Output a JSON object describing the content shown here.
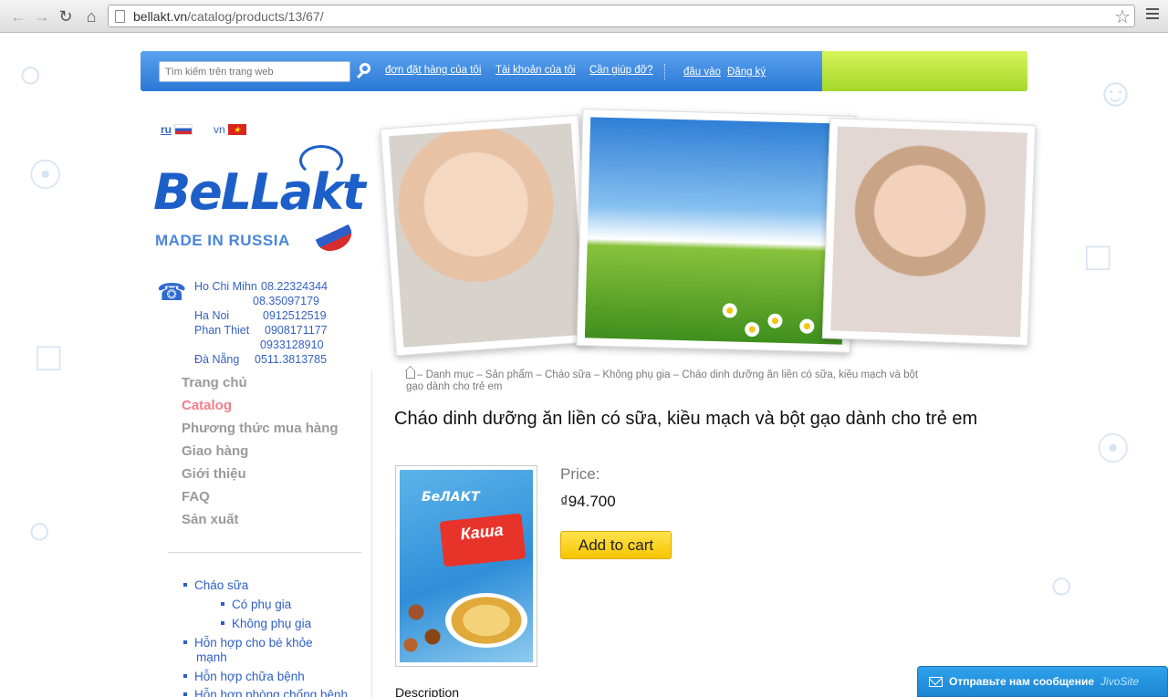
{
  "browser": {
    "url_host": "bellakt.vn",
    "url_path": "/catalog/products/13/67/"
  },
  "topbar": {
    "search_placeholder": "Tìm kiếm trên trang web",
    "links": [
      "đơn đặt hàng của tôi",
      "Tài khoản của tôi",
      "Cần giúp đỡ?"
    ],
    "login": "đâu vào",
    "register": "Đăng ký"
  },
  "languages": [
    {
      "code": "ru",
      "flag": "russia-flag"
    },
    {
      "code": "vn",
      "flag": "vietnam-flag"
    }
  ],
  "logo": {
    "brand": "BeLLakt",
    "tagline": "MADE IN RUSSIA"
  },
  "contacts": {
    "hcm_label": "Ho Chi Mihn",
    "hcm_phone1": "08.22324344",
    "hcm_phone2": "08.35097179",
    "hanoi_label": "Ha Noi",
    "hanoi_phone": "0912512519",
    "phanthiet_label": "Phan Thiet",
    "phanthiet_phone1": "0908171177",
    "phanthiet_phone2": "0933128910",
    "danang_label": "Đà Nẵng",
    "danang_phone": "0511.3813785"
  },
  "menu": [
    "Trang chủ",
    "Catalog",
    "Phương thức mua hàng",
    "Giao hàng",
    "Giới thiệu",
    "FAQ",
    "Sản xuất"
  ],
  "categories": [
    {
      "label": "Cháo sữa"
    },
    {
      "label": "Có phụ gia"
    },
    {
      "label": "Không phụ gia"
    },
    {
      "label": "Hỗn hợp cho bé khỏe"
    },
    {
      "label": "mạnh"
    },
    {
      "label": "Hỗn hợp chữa bệnh"
    },
    {
      "label": "Hỗn hợp phòng chống bệnh"
    }
  ],
  "breadcrumb": {
    "line1": "– Danh mục – Sản phẩm – Cháo sữa – Không phụ gia –  Cháo dinh dưỡng ăn liền có sữa, kiều mạch và bột",
    "line2": "gạo dành cho trẻ em"
  },
  "product": {
    "title": "Cháo dinh dưỡng ăn liền có sữa, kiều mạch và bột gạo dành cho trẻ em",
    "box_brand": "БеЛАКТ",
    "box_name": "Каша",
    "price_label": "Price:",
    "price": "₫94.700",
    "add_to_cart": "Add to cart",
    "description_heading": "Description"
  },
  "chat_widget": {
    "message": "Отправьте нам сообщение",
    "brand": "JivoSite"
  },
  "colors": {
    "topbar_blue": "#2a78d6",
    "topbar_green": "#a5d82a",
    "menu_active": "#f47c8a",
    "link_blue": "#2e5fc4"
  }
}
